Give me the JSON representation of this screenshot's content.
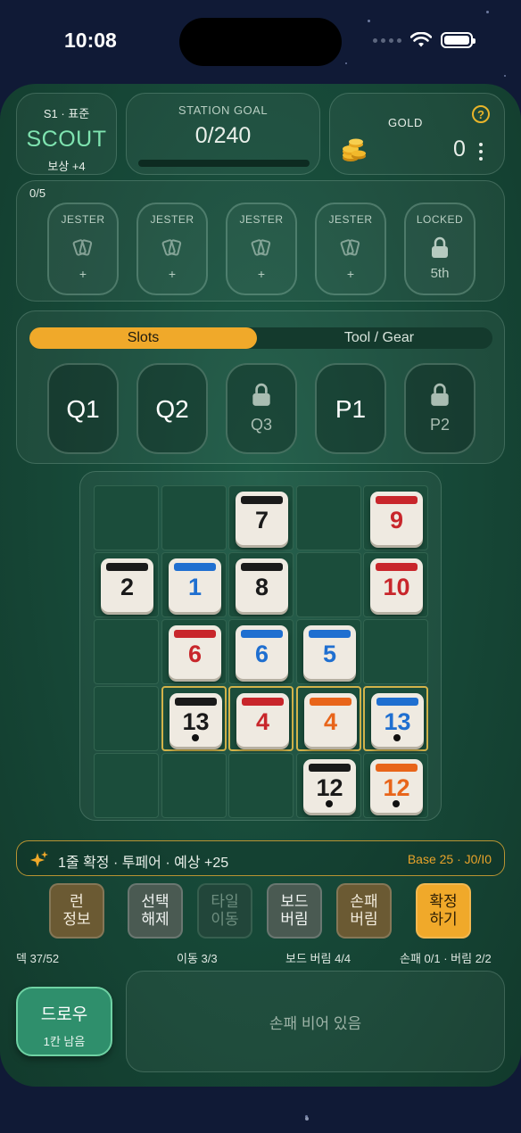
{
  "status": {
    "time": "10:08"
  },
  "header": {
    "season": "S1 · 표준",
    "tier": "SCOUT",
    "reward": "보상 +4",
    "goal_label": "STATION GOAL",
    "goal_value": "0/240",
    "goal_progress": 0,
    "gold_label": "GOLD",
    "gold_amount": "0",
    "help": "?"
  },
  "jesters": {
    "count": "0/5",
    "slots": [
      {
        "label": "JESTER",
        "sub": "+"
      },
      {
        "label": "JESTER",
        "sub": "+"
      },
      {
        "label": "JESTER",
        "sub": "+"
      },
      {
        "label": "JESTER",
        "sub": "+"
      },
      {
        "label": "LOCKED",
        "sub": "5th"
      }
    ]
  },
  "slots": {
    "tabs": [
      "Slots",
      "Tool / Gear"
    ],
    "items": [
      "Q1",
      "Q2",
      "Q3",
      "P1",
      "P2"
    ]
  },
  "board": {
    "tiles": [
      {
        "number": "7",
        "color": "black"
      },
      {
        "number": "9",
        "color": "red"
      },
      {
        "number": "2",
        "color": "black"
      },
      {
        "number": "1",
        "color": "blue"
      },
      {
        "number": "8",
        "color": "black"
      },
      {
        "number": "10",
        "color": "red"
      },
      {
        "number": "6",
        "color": "red"
      },
      {
        "number": "6",
        "color": "blue"
      },
      {
        "number": "5",
        "color": "blue"
      },
      {
        "number": "13",
        "color": "black"
      },
      {
        "number": "4",
        "color": "red"
      },
      {
        "number": "4",
        "color": "orange"
      },
      {
        "number": "13",
        "color": "blue"
      },
      {
        "number": "12",
        "color": "black"
      },
      {
        "number": "12",
        "color": "orange"
      }
    ],
    "colors": {
      "black": "#1a1a1a",
      "red": "#c8262b",
      "blue": "#1f6fd0",
      "orange": "#e8651a"
    }
  },
  "info": {
    "text": "1줄 확정 · 투페어 · 예상 +25",
    "base": "Base 25 · J0/I0"
  },
  "actions": [
    {
      "label": "런\n정보"
    },
    {
      "label": "선택\n해제"
    },
    {
      "label": "타일\n이동"
    },
    {
      "label": "보드\n버림"
    },
    {
      "label": "손패\n버림"
    },
    {
      "label": "확정\n하기"
    }
  ],
  "stats": {
    "deck": "덱 37/52",
    "move": "이동 3/3",
    "board_discard": "보드 버림 4/4",
    "hand": "손패 0/1 · 버림 2/2"
  },
  "draw": {
    "label": "드로우",
    "sub": "1칸 남음"
  },
  "hand": {
    "empty": "손패 비어 있음"
  }
}
